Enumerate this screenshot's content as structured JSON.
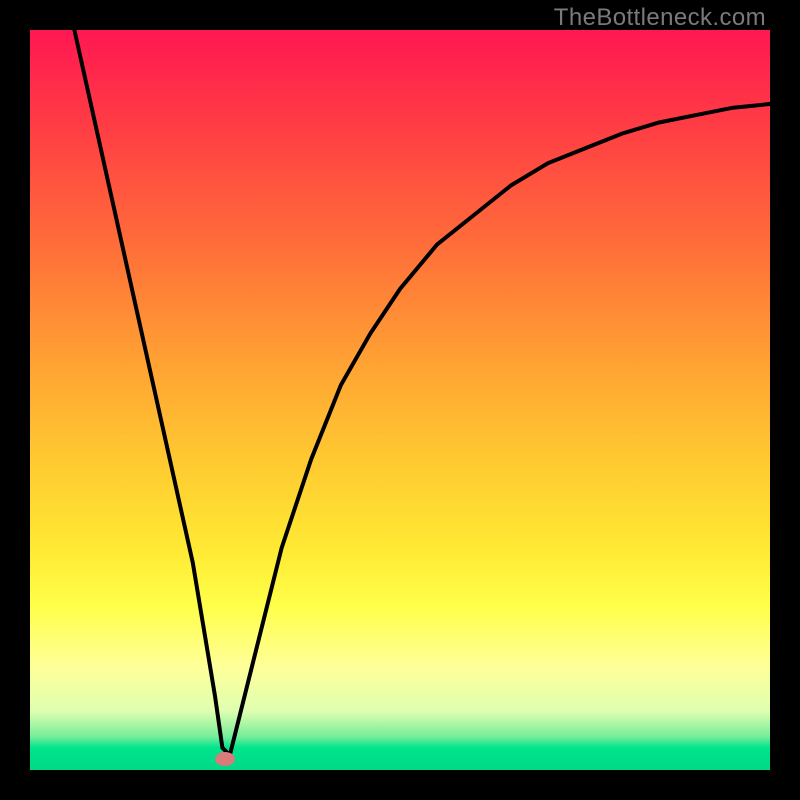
{
  "watermark": "TheBottleneck.com",
  "chart_data": {
    "type": "line",
    "title": "",
    "xlabel": "",
    "ylabel": "",
    "xlim": [
      0,
      100
    ],
    "ylim": [
      0,
      100
    ],
    "grid": false,
    "legend": false,
    "series": [
      {
        "name": "bottleneck-curve",
        "x": [
          6,
          10,
          14,
          18,
          22,
          25,
          26,
          27,
          30,
          34,
          38,
          42,
          46,
          50,
          55,
          60,
          65,
          70,
          75,
          80,
          85,
          90,
          95,
          100
        ],
        "y": [
          100,
          82,
          64,
          46,
          28,
          10,
          3,
          2,
          14,
          30,
          42,
          52,
          59,
          65,
          71,
          75,
          79,
          82,
          84,
          86,
          87.5,
          88.5,
          89.5,
          90
        ]
      }
    ],
    "marker": {
      "x": 26.3,
      "y": 1.5
    },
    "gradient_stops": [
      {
        "pos": 0,
        "color": "#ff1752"
      },
      {
        "pos": 12,
        "color": "#ff3a45"
      },
      {
        "pos": 28,
        "color": "#ff6a3a"
      },
      {
        "pos": 45,
        "color": "#ffa233"
      },
      {
        "pos": 58,
        "color": "#ffc931"
      },
      {
        "pos": 70,
        "color": "#ffe933"
      },
      {
        "pos": 78,
        "color": "#ffff4a"
      },
      {
        "pos": 86,
        "color": "#ffff99"
      },
      {
        "pos": 92,
        "color": "#dfffb0"
      },
      {
        "pos": 95.5,
        "color": "#76ed9a"
      },
      {
        "pos": 97,
        "color": "#00e58c"
      },
      {
        "pos": 100,
        "color": "#00d885"
      }
    ]
  }
}
